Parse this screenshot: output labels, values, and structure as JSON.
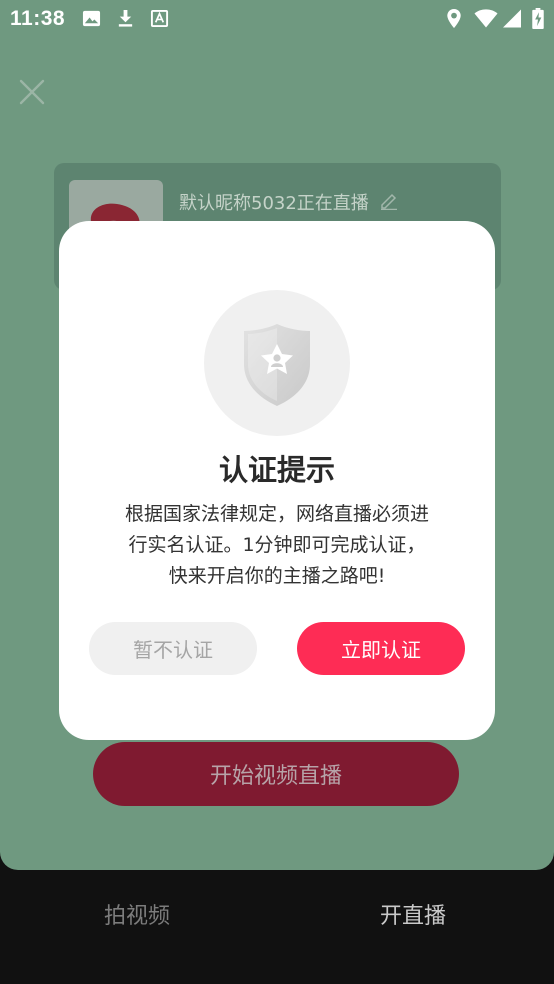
{
  "status_bar": {
    "time": "11:38",
    "icons": [
      "image-icon",
      "download-icon",
      "text-box-icon",
      "location-icon",
      "wifi-icon",
      "signal-icon",
      "battery-charging-icon"
    ]
  },
  "live_setup": {
    "nickname": "默认昵称5032正在直播",
    "start_button_label": "开始视频直播"
  },
  "bottom_nav": {
    "tabs": [
      {
        "label": "拍视频"
      },
      {
        "label": "开直播"
      }
    ],
    "active_index": 1
  },
  "dialog": {
    "title": "认证提示",
    "body_lines": [
      "根据国家法律规定，网络直播必须进",
      "行实名认证。1分钟即可完成认证，",
      "快来开启你的主播之路吧!"
    ],
    "cancel_label": "暂不认证",
    "confirm_label": "立即认证",
    "icon": "shield-star-icon"
  },
  "colors": {
    "accent": "#fe2c55",
    "overlay_background": "#6f9980"
  }
}
